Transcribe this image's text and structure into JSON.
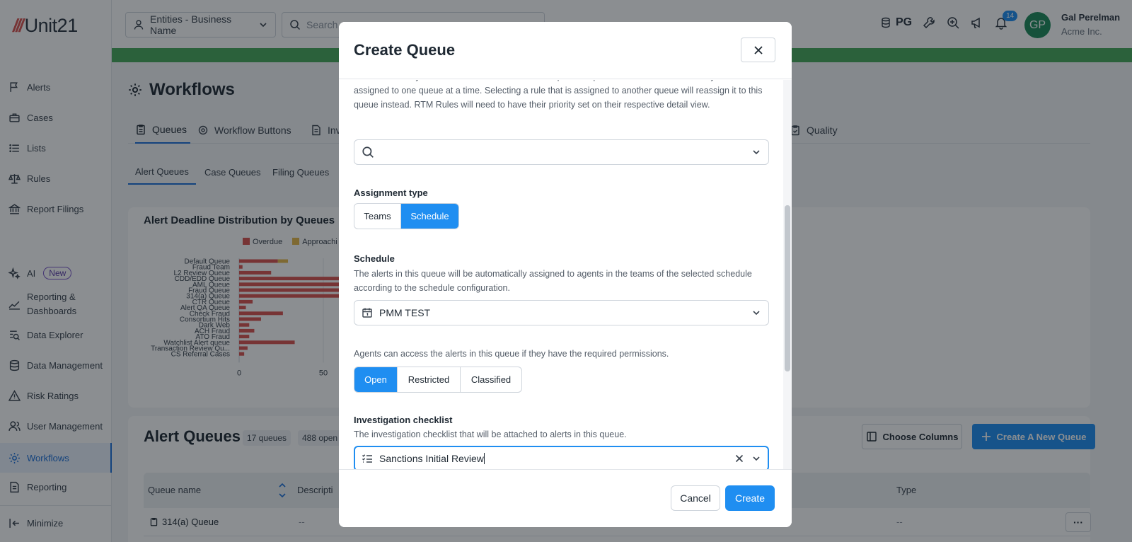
{
  "app": {
    "logo_text": "Unit21",
    "entity_selector": "Entities - Business Name",
    "search_placeholder": "Search",
    "env_label": "PG",
    "notification_count": "14",
    "user": {
      "initials": "GP",
      "name": "Gal Perelman",
      "org": "Acme Inc."
    }
  },
  "sidebar": {
    "items": [
      {
        "label": "Alerts",
        "icon": "flag-icon"
      },
      {
        "label": "Cases",
        "icon": "briefcase-icon"
      },
      {
        "label": "Lists",
        "icon": "list-icon"
      },
      {
        "label": "Rules",
        "icon": "scale-icon"
      },
      {
        "label": "Report Filings",
        "icon": "bank-icon"
      },
      {
        "label": "AI",
        "icon": "sparkle-icon",
        "badge": "New"
      },
      {
        "label": "Reporting &",
        "label2": "Dashboards",
        "icon": "chart-icon"
      },
      {
        "label": "Data Explorer",
        "icon": "data-search-icon"
      },
      {
        "label": "Data Management",
        "icon": "database-icon"
      },
      {
        "label": "Risk Ratings",
        "icon": "warning-icon"
      },
      {
        "label": "User Management",
        "icon": "users-icon"
      },
      {
        "label": "Workflows",
        "icon": "gear-icon",
        "active": true
      },
      {
        "label": "Reporting",
        "icon": "report-icon"
      },
      {
        "label": "Minimize",
        "icon": "collapse-icon"
      }
    ]
  },
  "page": {
    "title": "Workflows",
    "tabs": [
      {
        "label": "Queues",
        "active": true
      },
      {
        "label": "Workflow Buttons"
      },
      {
        "label": "Inv"
      },
      {
        "label": "Quality"
      }
    ],
    "subtabs": [
      {
        "label": "Alert Queues",
        "active": true
      },
      {
        "label": "Case Queues"
      },
      {
        "label": "Filing Queues"
      }
    ]
  },
  "chart_data": {
    "type": "bar",
    "title": "Alert Deadline Distribution by Queues",
    "legend": [
      "Overdue",
      "Approachi"
    ],
    "colors": {
      "Overdue": "#d9534f",
      "Approaching": "#e6b94a"
    },
    "categories": [
      "Default Queue",
      "Fraud Team",
      "L2 Review Queue",
      "CDD/EDD Queue",
      "AML Queue",
      "Fraud Queue",
      "314(a) Queue",
      "CTR Queue",
      "Alert QA Queue",
      "Check Fraud",
      "Consortium Hits",
      "Dark Web",
      "ACH Fraud",
      "ATO Fraud",
      "Watchlist Alert queue",
      "Transaction Review Qu...",
      "CS Referral Cases"
    ],
    "series": [
      {
        "name": "Overdue",
        "values": [
          23,
          2,
          19,
          100,
          100,
          100,
          100,
          8,
          4,
          26,
          13,
          6,
          9,
          6,
          33,
          5,
          3
        ]
      },
      {
        "name": "Approaching",
        "values": [
          6,
          0,
          0,
          0,
          0,
          0,
          0,
          0,
          0,
          0,
          0,
          0,
          0,
          0,
          0,
          0,
          0
        ]
      }
    ],
    "x_ticks": [
      "0",
      "50"
    ],
    "xlim": [
      0,
      60
    ]
  },
  "alert_queues": {
    "title": "Alert Queues",
    "count_pill": "17 queues",
    "open_pill": "488 open",
    "choose_columns": "Choose Columns",
    "create_new": "Create A New Queue",
    "columns": {
      "name": "Queue name",
      "description": "Descripti",
      "type": "Type"
    },
    "rows": [
      {
        "name": "314(a) Queue",
        "description": "--",
        "type": "--",
        "menu": "···"
      }
    ]
  },
  "modal": {
    "title": "Create Queue",
    "rules_help": "Alerts created by the selected rules here will show up in this queue. Note: each rule can only be assigned to one queue at a time. Selecting a rule that is assigned to another queue will reassign it to this queue instead. RTM Rules will need to have their priority set on their respective detail view.",
    "assignment_type": {
      "label": "Assignment type",
      "options": [
        "Teams",
        "Schedule"
      ],
      "selected": "Schedule"
    },
    "schedule": {
      "label": "Schedule",
      "help": "The alerts in this queue will be automatically assigned to agents in the teams of the selected schedule according to the schedule configuration.",
      "value": "PMM TEST"
    },
    "access": {
      "help": "Agents can access the alerts in this queue if they have the required permissions.",
      "options": [
        "Open",
        "Restricted",
        "Classified"
      ],
      "selected": "Open"
    },
    "checklist": {
      "label": "Investigation checklist",
      "help": "The investigation checklist that will be attached to alerts in this queue.",
      "value": "Sanctions Initial Review"
    },
    "cancel": "Cancel",
    "create": "Create"
  }
}
